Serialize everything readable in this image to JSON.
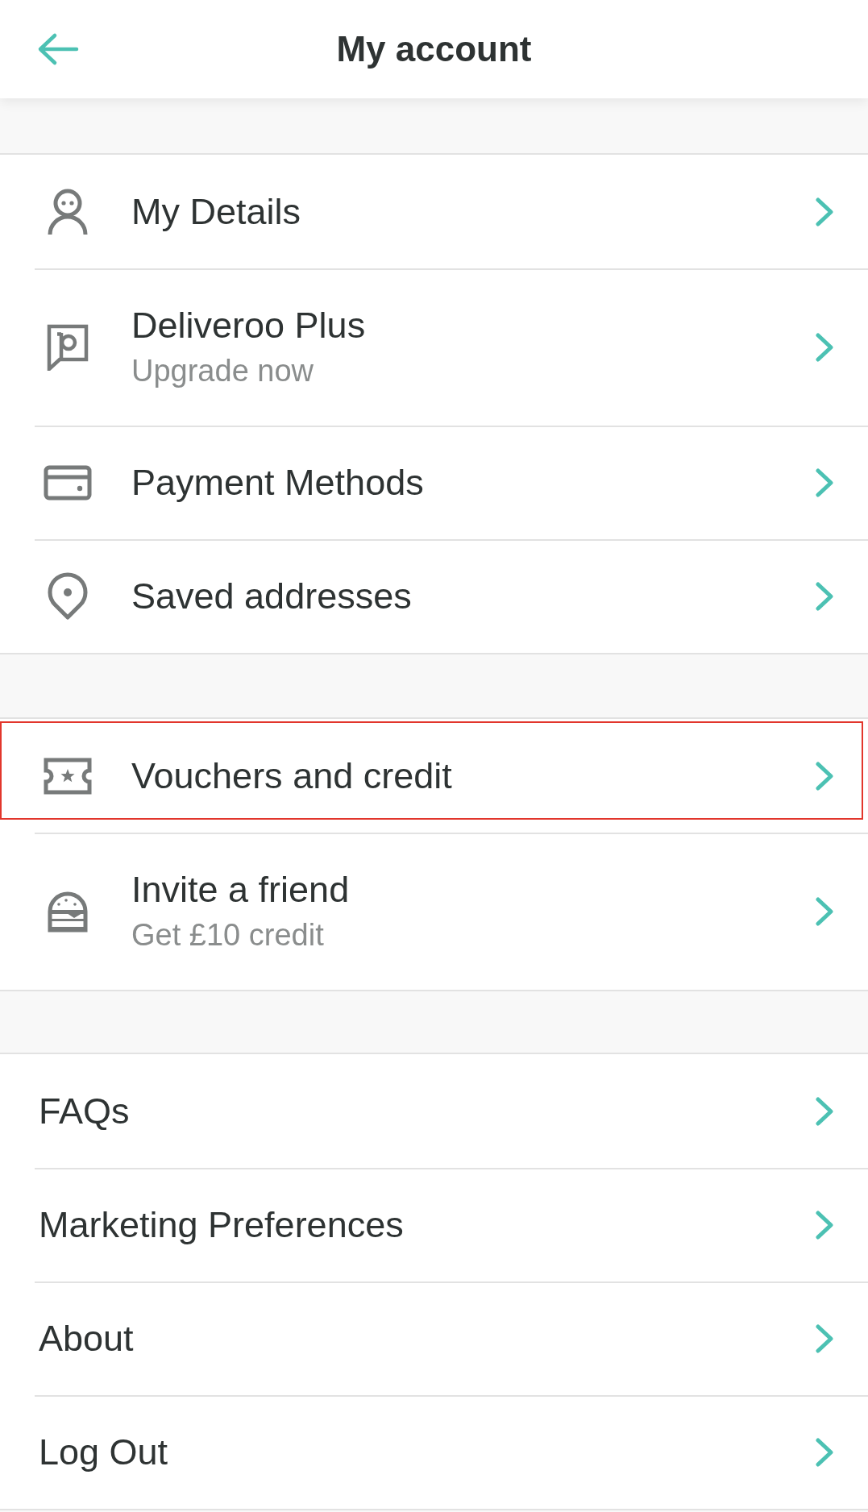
{
  "header": {
    "title": "My account"
  },
  "groups": [
    {
      "kind": "icons",
      "items": [
        {
          "title": "My Details",
          "highlighted": false
        },
        {
          "title": "Deliveroo Plus",
          "subtitle": "Upgrade now",
          "highlighted": false
        },
        {
          "title": "Payment Methods",
          "highlighted": false
        },
        {
          "title": "Saved addresses",
          "highlighted": false
        }
      ]
    },
    {
      "kind": "icons",
      "items": [
        {
          "title": "Vouchers and credit",
          "highlighted": true
        },
        {
          "title": "Invite a friend",
          "subtitle": "Get £10 credit",
          "highlighted": false
        }
      ]
    },
    {
      "kind": "plain",
      "items": [
        {
          "title": "FAQs",
          "highlighted": false
        },
        {
          "title": "Marketing Preferences",
          "highlighted": false
        },
        {
          "title": "About",
          "highlighted": false
        },
        {
          "title": "Log Out",
          "highlighted": false
        }
      ]
    }
  ]
}
